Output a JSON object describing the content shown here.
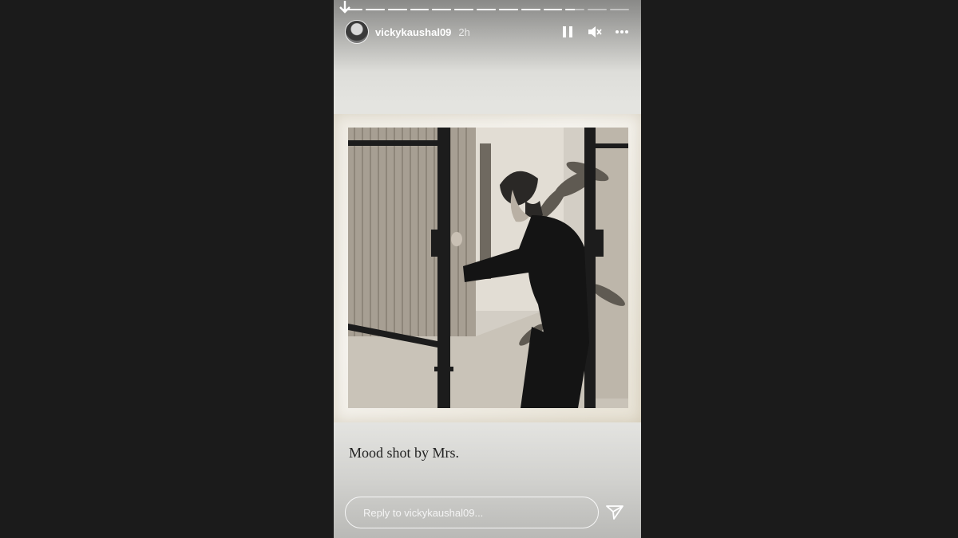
{
  "story": {
    "username": "vickykaushal09",
    "time": "2h",
    "caption": "Mood shot by Mrs.",
    "progress": {
      "segments": 13,
      "completed": 10,
      "current_fraction": 0.5
    }
  },
  "reply": {
    "placeholder": "Reply to vickykaushal09..."
  },
  "icons": {
    "download": "down-arrow-icon",
    "pause": "pause-icon",
    "mute": "muted-speaker-icon",
    "more": "more-dots-icon",
    "send": "send-icon"
  },
  "colors": {
    "page_background": "#1b1b1b",
    "text_light": "#ffffff"
  }
}
